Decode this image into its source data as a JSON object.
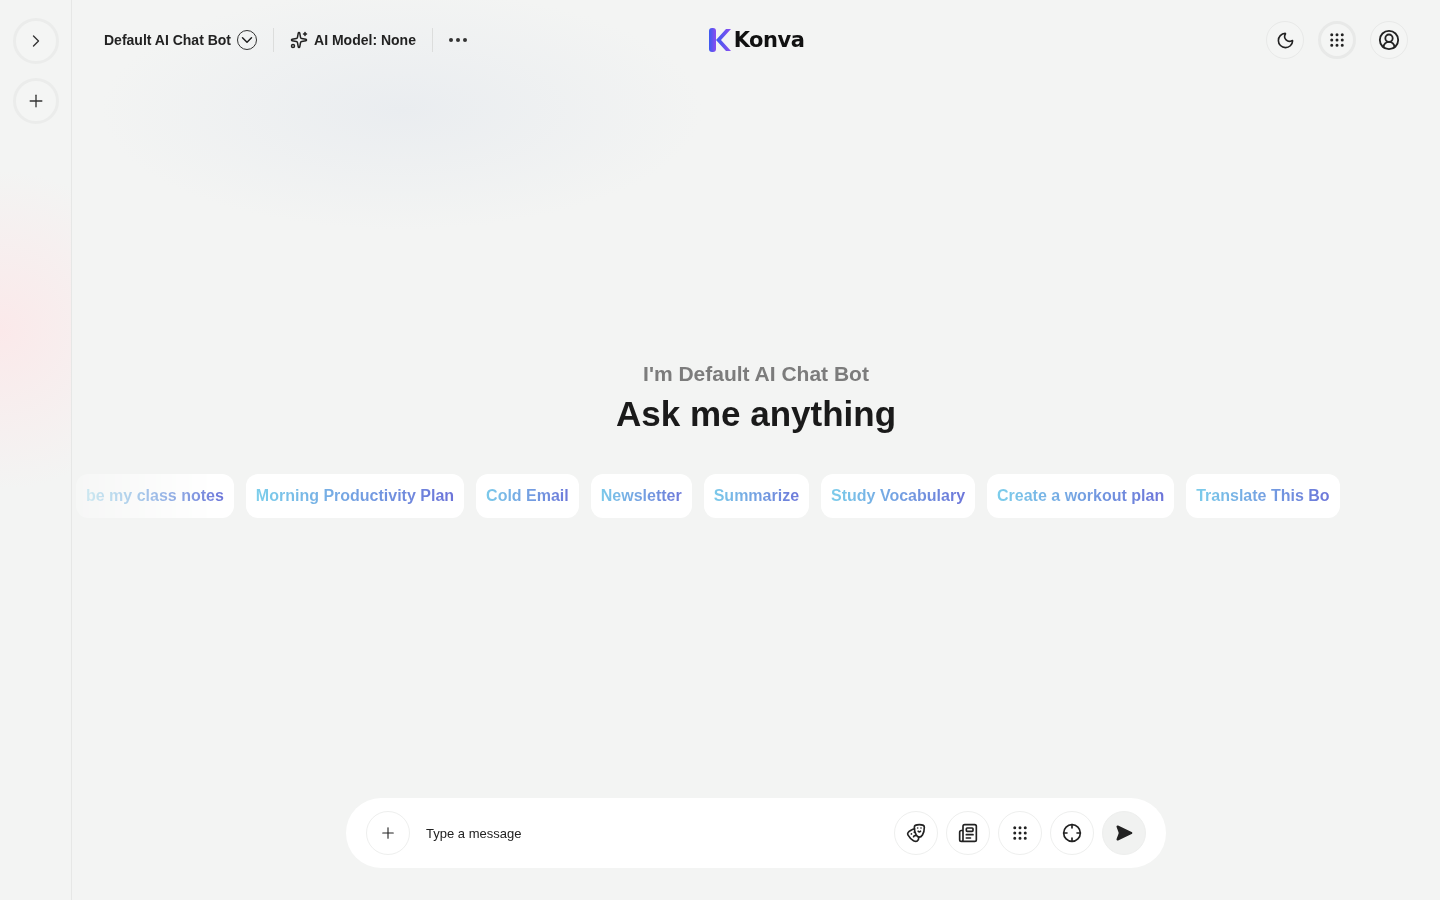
{
  "sidebar": {
    "buttons": [
      {
        "kind": "expand"
      },
      {
        "kind": "new"
      }
    ]
  },
  "header": {
    "bot_name": "Default AI Chat Bot",
    "model": "AI Model: None",
    "logo": "Konva"
  },
  "hero": {
    "subtitle": "I'm Default AI Chat Bot",
    "title": "Ask me anything"
  },
  "suggestions": [
    "be my class notes",
    "Morning Productivity Plan",
    "Cold Email",
    "Newsletter",
    "Summarize",
    "Study Vocabulary",
    "Create a workout plan",
    "Translate This Bo"
  ],
  "composer": {
    "placeholder": "Type a message"
  }
}
